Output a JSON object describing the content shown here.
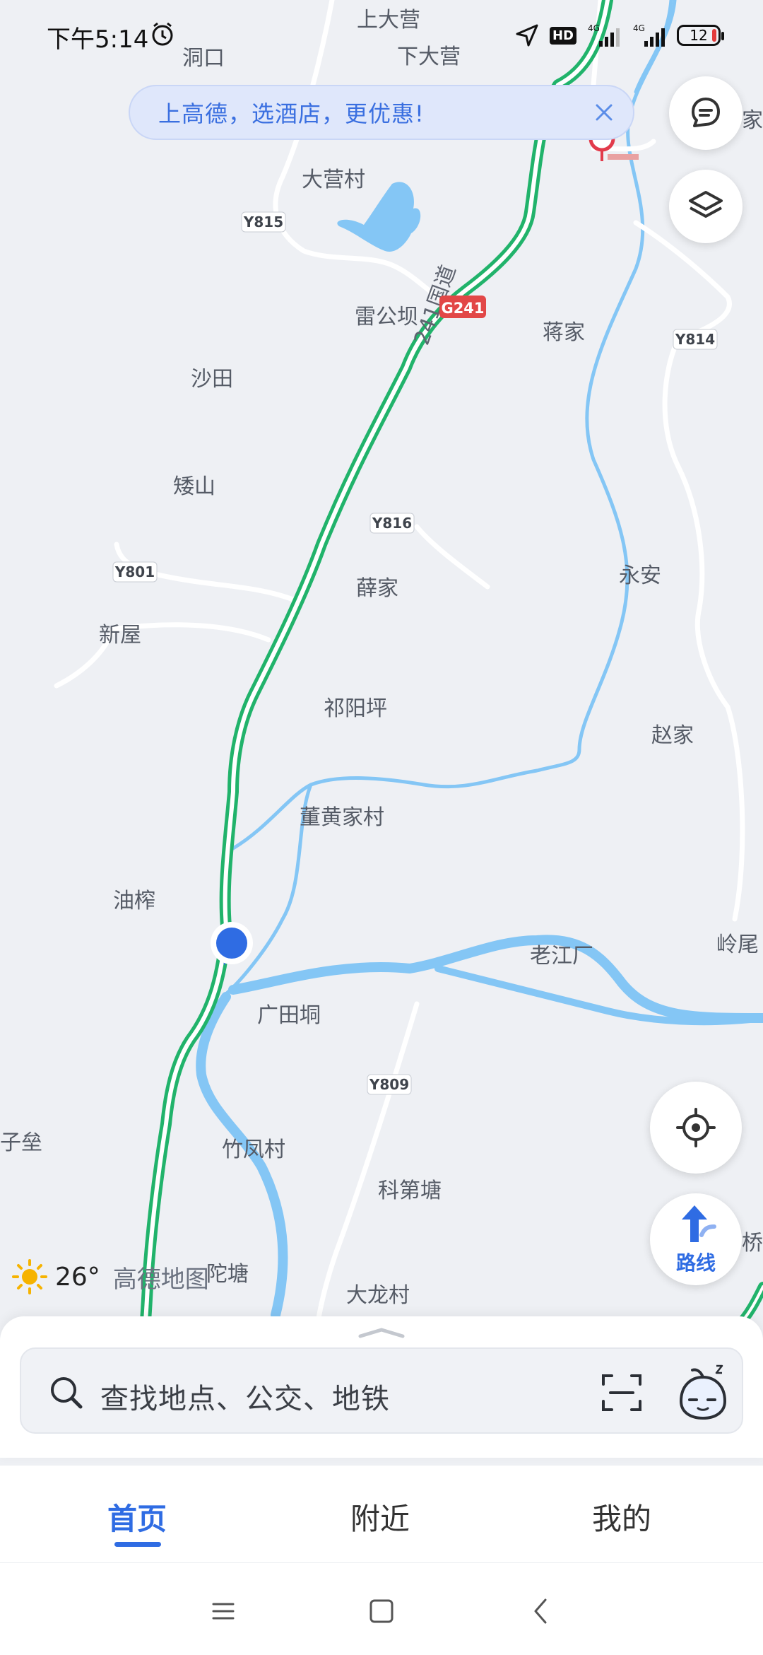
{
  "status": {
    "time": "下午5:14",
    "hd": "HD",
    "net1": "4G",
    "net2": "4G",
    "battery": "12"
  },
  "promo": {
    "text": "上高德，选酒店，更优惠!"
  },
  "map": {
    "places": [
      "洞口",
      "上大营",
      "下大营",
      "家",
      "大营村",
      "雷公坝",
      "蒋家",
      "沙田",
      "矮山",
      "薛家",
      "永安",
      "新屋",
      "祁阳坪",
      "赵家",
      "董黄家村",
      "油榨",
      "老江厂",
      "岭尾",
      "广田垌",
      "子垒",
      "竹凤村",
      "科第塘",
      "陀塘",
      "大龙村",
      "桥"
    ],
    "road_badges": [
      "G241",
      "Y815",
      "Y814",
      "Y816",
      "Y801",
      "Y809"
    ],
    "highway_name": "241国道",
    "colors": {
      "highway": "#21b36b",
      "river": "#84c6f5",
      "road": "#ffffff",
      "location": "#2f6ce3"
    }
  },
  "controls": {
    "chat": "message-icon",
    "layers": "layers-icon",
    "locate": "locate-icon",
    "route_label": "路线"
  },
  "weather": {
    "temp": "26°",
    "brand": "高德地图"
  },
  "search": {
    "placeholder": "查找地点、公交、地铁"
  },
  "tabs": [
    {
      "label": "首页",
      "active": true
    },
    {
      "label": "附近"
    },
    {
      "label": "我的"
    }
  ]
}
